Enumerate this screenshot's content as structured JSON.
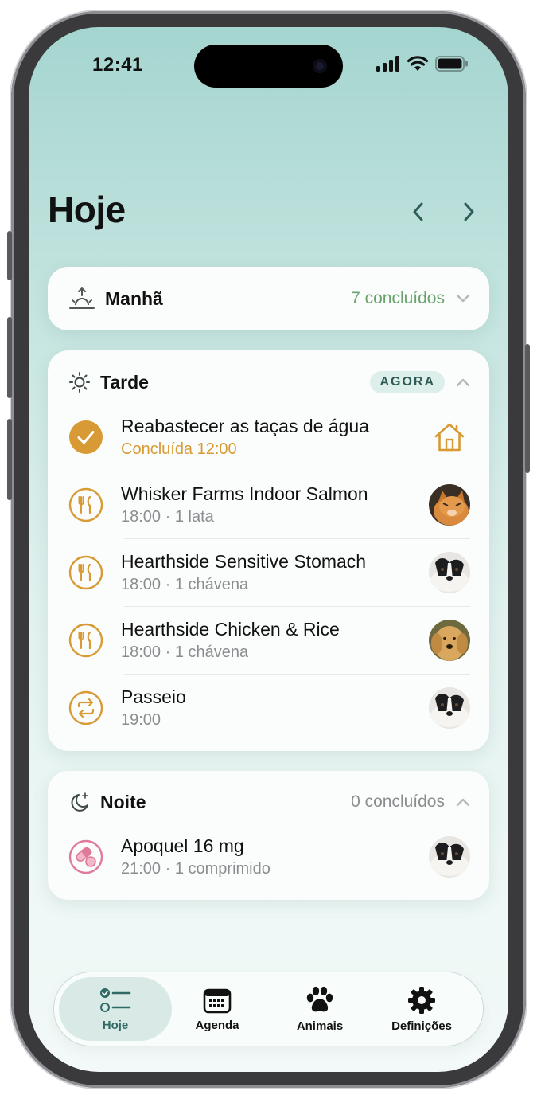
{
  "status_bar": {
    "time": "12:41"
  },
  "header": {
    "title": "Hoje"
  },
  "sections": {
    "morning": {
      "label": "Manhã",
      "count": "7 concluídos"
    },
    "afternoon": {
      "label": "Tarde",
      "badge": "AGORA",
      "tasks": [
        {
          "title": "Reabastecer as taças de água",
          "subtitle": "Concluída 12:00",
          "icon": "check-icon",
          "right": "house-icon"
        },
        {
          "title": "Whisker Farms Indoor Salmon",
          "subtitle": "18:00 · 1 lata",
          "icon": "fork-knife-icon",
          "right": "cat-avatar"
        },
        {
          "title": "Hearthside Sensitive Stomach",
          "subtitle": "18:00 · 1 chávena",
          "icon": "fork-knife-icon",
          "right": "border-collie-avatar"
        },
        {
          "title": "Hearthside Chicken & Rice",
          "subtitle": "18:00 · 1 chávena",
          "icon": "fork-knife-icon",
          "right": "golden-retriever-avatar"
        },
        {
          "title": "Passeio",
          "subtitle": "19:00",
          "icon": "repeat-icon",
          "right": "border-collie-avatar"
        }
      ]
    },
    "night": {
      "label": "Noite",
      "count": "0 concluídos",
      "tasks": [
        {
          "title": "Apoquel 16 mg",
          "subtitle": "21:00 · 1 comprimido",
          "icon": "pill-icon",
          "right": "border-collie-avatar"
        }
      ]
    }
  },
  "tabbar": {
    "tabs": [
      {
        "label": "Hoje",
        "icon": "list-check-icon",
        "active": true
      },
      {
        "label": "Agenda",
        "icon": "calendar-icon"
      },
      {
        "label": "Animais",
        "icon": "paw-icon"
      },
      {
        "label": "Definições",
        "icon": "gear-icon"
      }
    ]
  },
  "colors": {
    "accent_orange": "#d79a34",
    "done_green": "#6aa36e",
    "pill_pink": "#e07a9a",
    "badge_bg": "#dcefea",
    "tab_active": "#2f6a63"
  }
}
